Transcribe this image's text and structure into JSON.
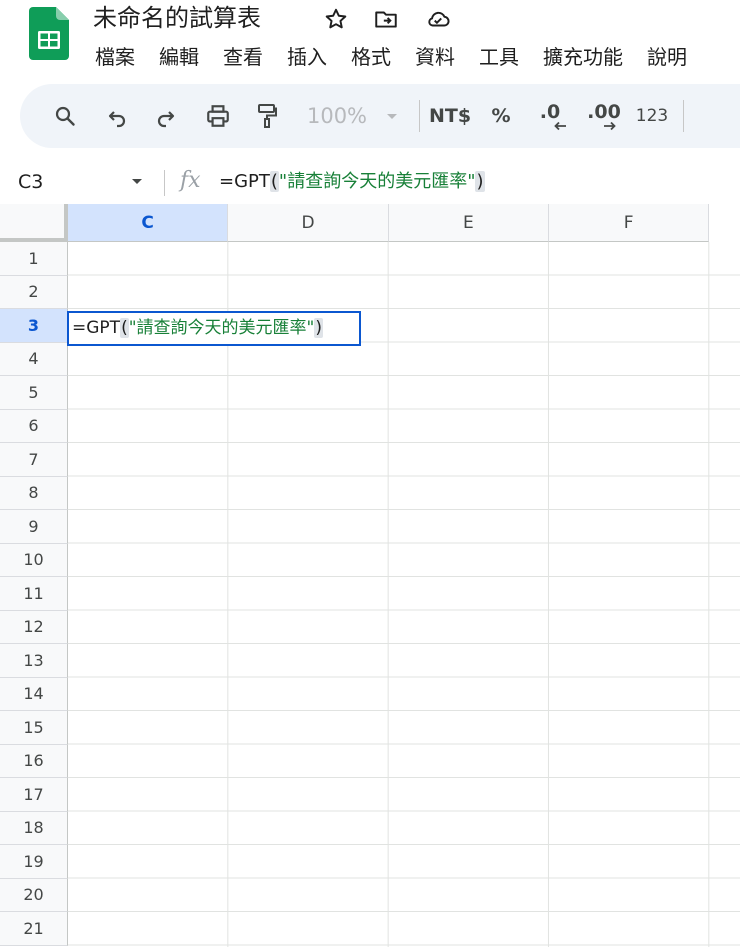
{
  "app": {
    "title": "未命名的試算表",
    "brand_color": "#0f9d58"
  },
  "title_icons": [
    "star-icon",
    "move-to-folder-icon",
    "cloud-saved-icon"
  ],
  "menu": [
    "檔案",
    "編輯",
    "查看",
    "插入",
    "格式",
    "資料",
    "工具",
    "擴充功能",
    "說明"
  ],
  "toolbar": {
    "zoom": "100%",
    "currency": "NT$",
    "percent": "%",
    "decrease_decimal": ".0",
    "increase_decimal": ".00",
    "number_format": "123",
    "icons": [
      "search-icon",
      "undo-icon",
      "redo-icon",
      "print-icon",
      "paint-format-icon",
      "chevron-down-icon"
    ]
  },
  "formula_bar": {
    "name_box": "C3",
    "fx": "fx",
    "formula_prefix": "=GPT",
    "open_paren": "(",
    "string_arg": "\"請查詢今天的美元匯率\"",
    "close_paren": ")"
  },
  "grid": {
    "columns": [
      "C",
      "D",
      "E",
      "F"
    ],
    "selected_column": "C",
    "rows": [
      "1",
      "2",
      "3",
      "4",
      "5",
      "6",
      "7",
      "8",
      "9",
      "10",
      "11",
      "12",
      "13",
      "14",
      "15",
      "16",
      "17",
      "18",
      "19",
      "20",
      "21"
    ],
    "selected_row": "3",
    "active_cell": {
      "ref": "C3",
      "prefix": "=GPT",
      "open_paren": "(",
      "string_arg": "\"請查詢今天的美元匯率\"",
      "close_paren": ")"
    }
  },
  "colors": {
    "selection": "#0b57d0",
    "selection_header_bg": "#d3e3fd",
    "string_literal": "#188038",
    "toolbar_bg": "#f0f4f9"
  }
}
